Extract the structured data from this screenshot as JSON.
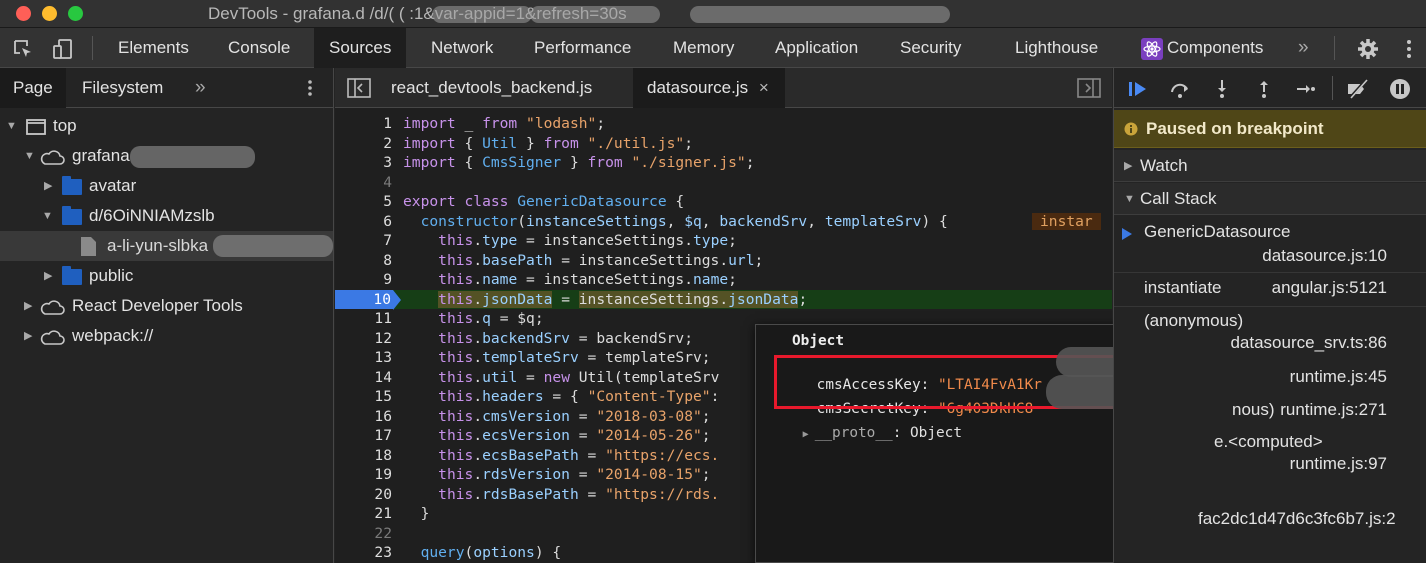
{
  "window": {
    "title": "DevTools - grafana.d              /d/(                        (                                  :1&var-appid=1&refresh=30s"
  },
  "toolbar": {
    "tabs": [
      "Elements",
      "Console",
      "Sources",
      "Network",
      "Performance",
      "Memory",
      "Application",
      "Security",
      "Lighthouse",
      "Components"
    ],
    "active_tab": "Sources",
    "more": "»"
  },
  "navigator": {
    "tabs": [
      "Page",
      "Filesystem"
    ],
    "more": "»",
    "tree": [
      {
        "label": "top"
      },
      {
        "label": "grafana"
      },
      {
        "label": "avatar"
      },
      {
        "label": "d/6OiNNIAMzslb"
      },
      {
        "label": "a-li-yun-slbka"
      },
      {
        "label": "public"
      },
      {
        "label": "React Developer Tools"
      },
      {
        "label": "webpack://"
      }
    ]
  },
  "editor": {
    "tabs": [
      {
        "label": "react_devtools_backend.js"
      },
      {
        "label": "datasource.js",
        "close": "×"
      }
    ],
    "breakpoint_line": 10,
    "inline_value": "instar",
    "line_numbers": [
      "1",
      "2",
      "3",
      "4",
      "5",
      "6",
      "7",
      "8",
      "9",
      "10",
      "11",
      "12",
      "13",
      "14",
      "15",
      "16",
      "17",
      "18",
      "19",
      "20",
      "21",
      "22",
      "23"
    ]
  },
  "popover": {
    "title": "Object",
    "rows": [
      {
        "key": "cmsAccessKey",
        "sep": ": ",
        "value": "\"LTAI4FvA1Kr"
      },
      {
        "key": "cmsSecretKey",
        "sep": ": ",
        "value": "\"6g403DkHC8"
      },
      {
        "key": "__proto__",
        "sep": ": ",
        "value": "Object"
      }
    ]
  },
  "debugger": {
    "paused_text": "Paused on breakpoint",
    "watch_label": "Watch",
    "callstack_label": "Call Stack",
    "frames": [
      {
        "fn": "GenericDatasource",
        "loc": "datasource.js:10"
      },
      {
        "fn": "instantiate",
        "loc": "angular.js:5121"
      },
      {
        "fn": "(anonymous)",
        "loc": "datasource_srv.ts:86"
      },
      {
        "fn": "",
        "loc": "runtime.js:45"
      },
      {
        "fn": "nous)",
        "loc": "runtime.js:271"
      },
      {
        "fn": "e.<computed>",
        "loc": "runtime.js:97"
      },
      {
        "fn": "",
        "loc": "fac2dc1d47d6c3fc6b7.js:2"
      }
    ]
  },
  "colors": {
    "accent": "#3b79e4",
    "breakpoint_line_bg": "#163e16",
    "paused_banner": "#4f4617",
    "redaction_box": "#e8192c"
  }
}
